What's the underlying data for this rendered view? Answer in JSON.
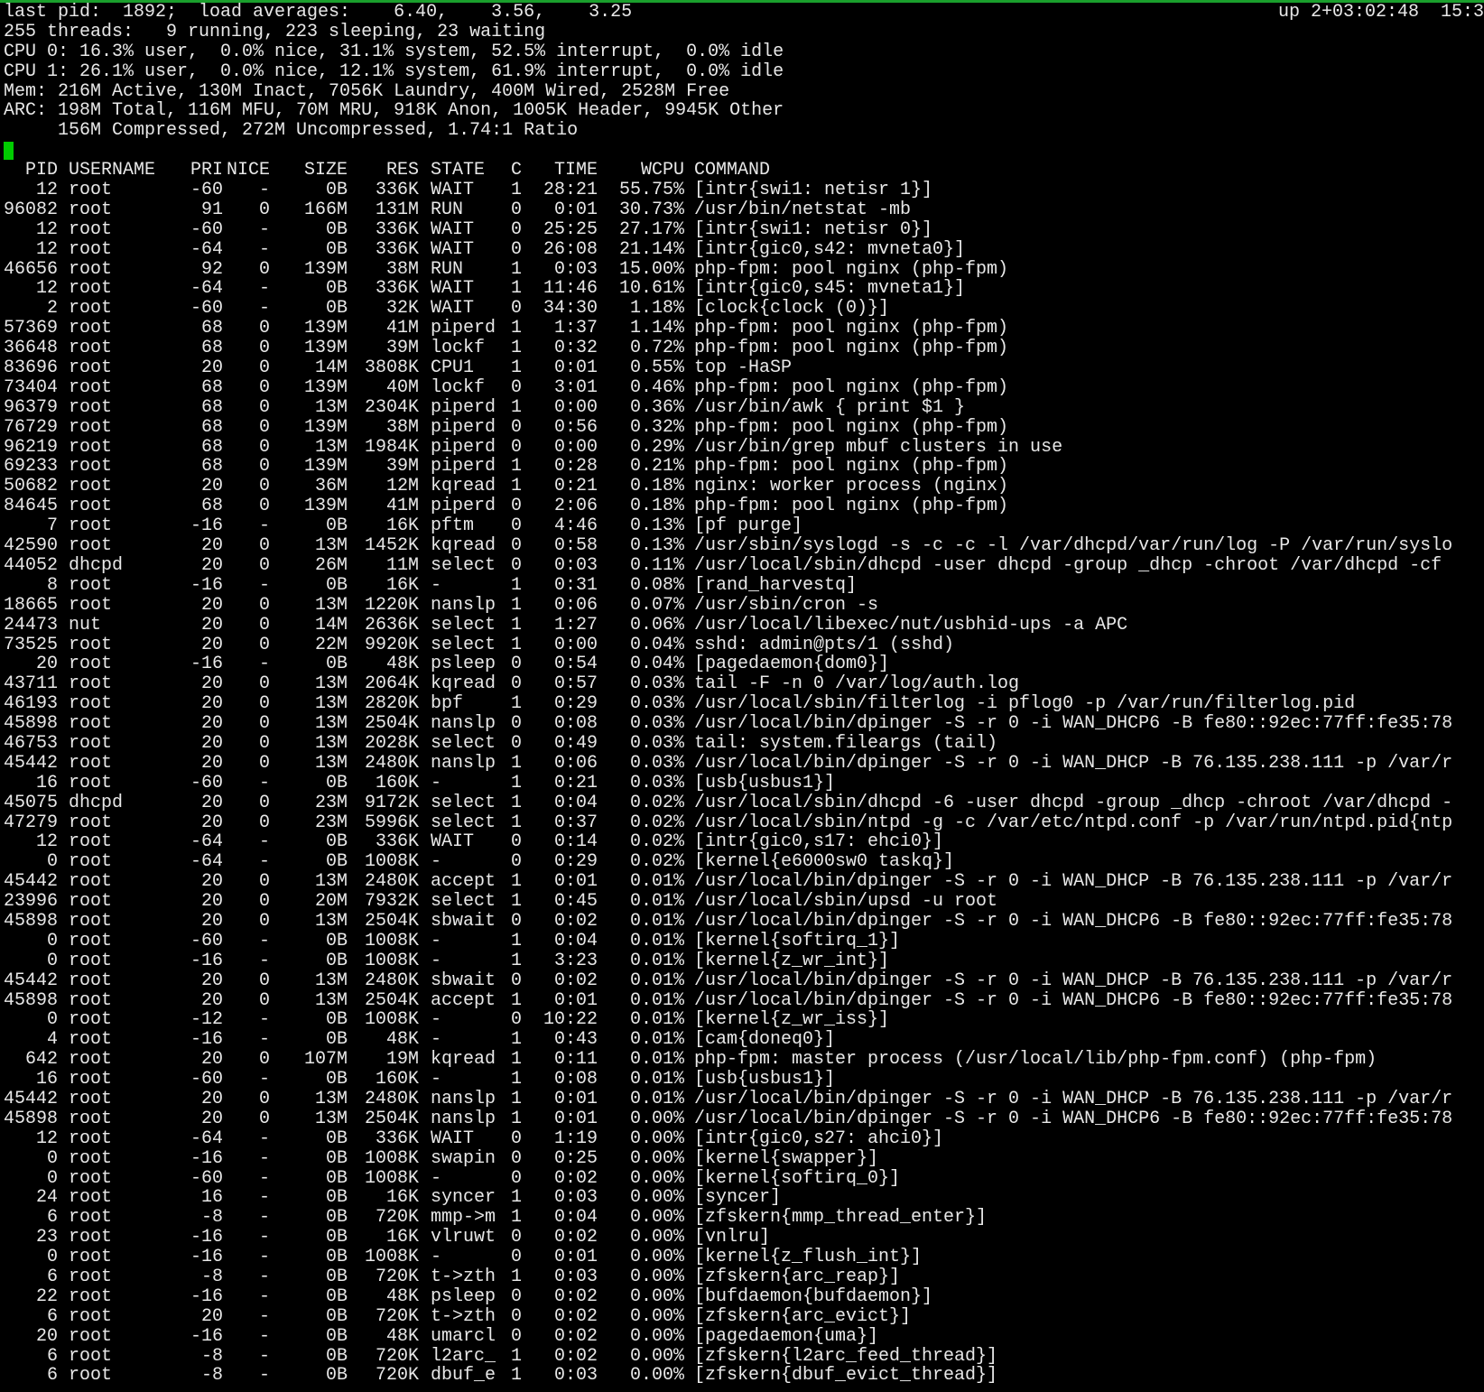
{
  "window": {
    "border_color": "#1a9f2c",
    "cursor_color": "#00cc00"
  },
  "summary": {
    "line1": "last pid:  1892;  load averages:    6.40,    3.56,    3.25",
    "uptime": "up 2+03:02:48  15:3",
    "line2": "255 threads:   9 running, 223 sleeping, 23 waiting",
    "line3": "CPU 0: 16.3% user,  0.0% nice, 31.1% system, 52.5% interrupt,  0.0% idle",
    "line4": "CPU 1: 26.1% user,  0.0% nice, 12.1% system, 61.9% interrupt,  0.0% idle",
    "line5": "Mem: 216M Active, 130M Inact, 7056K Laundry, 400M Wired, 2528M Free",
    "line6": "ARC: 198M Total, 116M MFU, 70M MRU, 918K Anon, 1005K Header, 9945K Other",
    "line7": "     156M Compressed, 272M Uncompressed, 1.74:1 Ratio"
  },
  "columns": [
    "PID",
    "USERNAME",
    "PRI",
    "NICE",
    "SIZE",
    "RES",
    "STATE",
    "C",
    "TIME",
    "WCPU",
    "COMMAND"
  ],
  "processes": [
    [
      "12",
      "root",
      "-60",
      "-",
      "0B",
      "336K",
      "WAIT",
      "1",
      "28:21",
      "55.75%",
      "[intr{swi1: netisr 1}]"
    ],
    [
      "96082",
      "root",
      "91",
      "0",
      "166M",
      "131M",
      "RUN",
      "0",
      "0:01",
      "30.73%",
      "/usr/bin/netstat -mb"
    ],
    [
      "12",
      "root",
      "-60",
      "-",
      "0B",
      "336K",
      "WAIT",
      "0",
      "25:25",
      "27.17%",
      "[intr{swi1: netisr 0}]"
    ],
    [
      "12",
      "root",
      "-64",
      "-",
      "0B",
      "336K",
      "WAIT",
      "0",
      "26:08",
      "21.14%",
      "[intr{gic0,s42: mvneta0}]"
    ],
    [
      "46656",
      "root",
      "92",
      "0",
      "139M",
      "38M",
      "RUN",
      "1",
      "0:03",
      "15.00%",
      "php-fpm: pool nginx (php-fpm)"
    ],
    [
      "12",
      "root",
      "-64",
      "-",
      "0B",
      "336K",
      "WAIT",
      "1",
      "11:46",
      "10.61%",
      "[intr{gic0,s45: mvneta1}]"
    ],
    [
      "2",
      "root",
      "-60",
      "-",
      "0B",
      "32K",
      "WAIT",
      "0",
      "34:30",
      "1.18%",
      "[clock{clock (0)}]"
    ],
    [
      "57369",
      "root",
      "68",
      "0",
      "139M",
      "41M",
      "piperd",
      "1",
      "1:37",
      "1.14%",
      "php-fpm: pool nginx (php-fpm)"
    ],
    [
      "36648",
      "root",
      "68",
      "0",
      "139M",
      "39M",
      "lockf",
      "1",
      "0:32",
      "0.72%",
      "php-fpm: pool nginx (php-fpm)"
    ],
    [
      "83696",
      "root",
      "20",
      "0",
      "14M",
      "3808K",
      "CPU1",
      "1",
      "0:01",
      "0.55%",
      "top -HaSP"
    ],
    [
      "73404",
      "root",
      "68",
      "0",
      "139M",
      "40M",
      "lockf",
      "0",
      "3:01",
      "0.46%",
      "php-fpm: pool nginx (php-fpm)"
    ],
    [
      "96379",
      "root",
      "68",
      "0",
      "13M",
      "2304K",
      "piperd",
      "1",
      "0:00",
      "0.36%",
      "/usr/bin/awk { print $1 }"
    ],
    [
      "76729",
      "root",
      "68",
      "0",
      "139M",
      "38M",
      "piperd",
      "0",
      "0:56",
      "0.32%",
      "php-fpm: pool nginx (php-fpm)"
    ],
    [
      "96219",
      "root",
      "68",
      "0",
      "13M",
      "1984K",
      "piperd",
      "0",
      "0:00",
      "0.29%",
      "/usr/bin/grep mbuf clusters in use"
    ],
    [
      "69233",
      "root",
      "68",
      "0",
      "139M",
      "39M",
      "piperd",
      "1",
      "0:28",
      "0.21%",
      "php-fpm: pool nginx (php-fpm)"
    ],
    [
      "50682",
      "root",
      "20",
      "0",
      "36M",
      "12M",
      "kqread",
      "1",
      "0:21",
      "0.18%",
      "nginx: worker process (nginx)"
    ],
    [
      "84645",
      "root",
      "68",
      "0",
      "139M",
      "41M",
      "piperd",
      "0",
      "2:06",
      "0.18%",
      "php-fpm: pool nginx (php-fpm)"
    ],
    [
      "7",
      "root",
      "-16",
      "-",
      "0B",
      "16K",
      "pftm",
      "0",
      "4:46",
      "0.13%",
      "[pf purge]"
    ],
    [
      "42590",
      "root",
      "20",
      "0",
      "13M",
      "1452K",
      "kqread",
      "0",
      "0:58",
      "0.13%",
      "/usr/sbin/syslogd -s -c -c -l /var/dhcpd/var/run/log -P /var/run/syslo"
    ],
    [
      "44052",
      "dhcpd",
      "20",
      "0",
      "26M",
      "11M",
      "select",
      "0",
      "0:03",
      "0.11%",
      "/usr/local/sbin/dhcpd -user dhcpd -group _dhcp -chroot /var/dhcpd -cf"
    ],
    [
      "8",
      "root",
      "-16",
      "-",
      "0B",
      "16K",
      "-",
      "1",
      "0:31",
      "0.08%",
      "[rand_harvestq]"
    ],
    [
      "18665",
      "root",
      "20",
      "0",
      "13M",
      "1220K",
      "nanslp",
      "1",
      "0:06",
      "0.07%",
      "/usr/sbin/cron -s"
    ],
    [
      "24473",
      "nut",
      "20",
      "0",
      "14M",
      "2636K",
      "select",
      "1",
      "1:27",
      "0.06%",
      "/usr/local/libexec/nut/usbhid-ups -a APC"
    ],
    [
      "73525",
      "root",
      "20",
      "0",
      "22M",
      "9920K",
      "select",
      "1",
      "0:00",
      "0.04%",
      "sshd: admin@pts/1 (sshd)"
    ],
    [
      "20",
      "root",
      "-16",
      "-",
      "0B",
      "48K",
      "psleep",
      "0",
      "0:54",
      "0.04%",
      "[pagedaemon{dom0}]"
    ],
    [
      "43711",
      "root",
      "20",
      "0",
      "13M",
      "2064K",
      "kqread",
      "0",
      "0:57",
      "0.03%",
      "tail -F -n 0 /var/log/auth.log"
    ],
    [
      "46193",
      "root",
      "20",
      "0",
      "13M",
      "2820K",
      "bpf",
      "1",
      "0:29",
      "0.03%",
      "/usr/local/sbin/filterlog -i pflog0 -p /var/run/filterlog.pid"
    ],
    [
      "45898",
      "root",
      "20",
      "0",
      "13M",
      "2504K",
      "nanslp",
      "0",
      "0:08",
      "0.03%",
      "/usr/local/bin/dpinger -S -r 0 -i WAN_DHCP6 -B fe80::92ec:77ff:fe35:78"
    ],
    [
      "46753",
      "root",
      "20",
      "0",
      "13M",
      "2028K",
      "select",
      "0",
      "0:49",
      "0.03%",
      "tail: system.fileargs (tail)"
    ],
    [
      "45442",
      "root",
      "20",
      "0",
      "13M",
      "2480K",
      "nanslp",
      "1",
      "0:06",
      "0.03%",
      "/usr/local/bin/dpinger -S -r 0 -i WAN_DHCP -B 76.135.238.111 -p /var/r"
    ],
    [
      "16",
      "root",
      "-60",
      "-",
      "0B",
      "160K",
      "-",
      "1",
      "0:21",
      "0.03%",
      "[usb{usbus1}]"
    ],
    [
      "45075",
      "dhcpd",
      "20",
      "0",
      "23M",
      "9172K",
      "select",
      "1",
      "0:04",
      "0.02%",
      "/usr/local/sbin/dhcpd -6 -user dhcpd -group _dhcp -chroot /var/dhcpd -"
    ],
    [
      "47279",
      "root",
      "20",
      "0",
      "23M",
      "5996K",
      "select",
      "1",
      "0:37",
      "0.02%",
      "/usr/local/sbin/ntpd -g -c /var/etc/ntpd.conf -p /var/run/ntpd.pid{ntp"
    ],
    [
      "12",
      "root",
      "-64",
      "-",
      "0B",
      "336K",
      "WAIT",
      "0",
      "0:14",
      "0.02%",
      "[intr{gic0,s17: ehci0}]"
    ],
    [
      "0",
      "root",
      "-64",
      "-",
      "0B",
      "1008K",
      "-",
      "0",
      "0:29",
      "0.02%",
      "[kernel{e6000sw0 taskq}]"
    ],
    [
      "45442",
      "root",
      "20",
      "0",
      "13M",
      "2480K",
      "accept",
      "1",
      "0:01",
      "0.01%",
      "/usr/local/bin/dpinger -S -r 0 -i WAN_DHCP -B 76.135.238.111 -p /var/r"
    ],
    [
      "23996",
      "root",
      "20",
      "0",
      "20M",
      "7932K",
      "select",
      "1",
      "0:45",
      "0.01%",
      "/usr/local/sbin/upsd -u root"
    ],
    [
      "45898",
      "root",
      "20",
      "0",
      "13M",
      "2504K",
      "sbwait",
      "0",
      "0:02",
      "0.01%",
      "/usr/local/bin/dpinger -S -r 0 -i WAN_DHCP6 -B fe80::92ec:77ff:fe35:78"
    ],
    [
      "0",
      "root",
      "-60",
      "-",
      "0B",
      "1008K",
      "-",
      "1",
      "0:04",
      "0.01%",
      "[kernel{softirq_1}]"
    ],
    [
      "0",
      "root",
      "-16",
      "-",
      "0B",
      "1008K",
      "-",
      "1",
      "3:23",
      "0.01%",
      "[kernel{z_wr_int}]"
    ],
    [
      "45442",
      "root",
      "20",
      "0",
      "13M",
      "2480K",
      "sbwait",
      "0",
      "0:02",
      "0.01%",
      "/usr/local/bin/dpinger -S -r 0 -i WAN_DHCP -B 76.135.238.111 -p /var/r"
    ],
    [
      "45898",
      "root",
      "20",
      "0",
      "13M",
      "2504K",
      "accept",
      "1",
      "0:01",
      "0.01%",
      "/usr/local/bin/dpinger -S -r 0 -i WAN_DHCP6 -B fe80::92ec:77ff:fe35:78"
    ],
    [
      "0",
      "root",
      "-12",
      "-",
      "0B",
      "1008K",
      "-",
      "0",
      "10:22",
      "0.01%",
      "[kernel{z_wr_iss}]"
    ],
    [
      "4",
      "root",
      "-16",
      "-",
      "0B",
      "48K",
      "-",
      "1",
      "0:43",
      "0.01%",
      "[cam{doneq0}]"
    ],
    [
      "642",
      "root",
      "20",
      "0",
      "107M",
      "19M",
      "kqread",
      "1",
      "0:11",
      "0.01%",
      "php-fpm: master process (/usr/local/lib/php-fpm.conf) (php-fpm)"
    ],
    [
      "16",
      "root",
      "-60",
      "-",
      "0B",
      "160K",
      "-",
      "1",
      "0:08",
      "0.01%",
      "[usb{usbus1}]"
    ],
    [
      "45442",
      "root",
      "20",
      "0",
      "13M",
      "2480K",
      "nanslp",
      "1",
      "0:01",
      "0.01%",
      "/usr/local/bin/dpinger -S -r 0 -i WAN_DHCP -B 76.135.238.111 -p /var/r"
    ],
    [
      "45898",
      "root",
      "20",
      "0",
      "13M",
      "2504K",
      "nanslp",
      "1",
      "0:01",
      "0.00%",
      "/usr/local/bin/dpinger -S -r 0 -i WAN_DHCP6 -B fe80::92ec:77ff:fe35:78"
    ],
    [
      "12",
      "root",
      "-64",
      "-",
      "0B",
      "336K",
      "WAIT",
      "0",
      "1:19",
      "0.00%",
      "[intr{gic0,s27: ahci0}]"
    ],
    [
      "0",
      "root",
      "-16",
      "-",
      "0B",
      "1008K",
      "swapin",
      "0",
      "0:25",
      "0.00%",
      "[kernel{swapper}]"
    ],
    [
      "0",
      "root",
      "-60",
      "-",
      "0B",
      "1008K",
      "-",
      "0",
      "0:02",
      "0.00%",
      "[kernel{softirq_0}]"
    ],
    [
      "24",
      "root",
      "16",
      "-",
      "0B",
      "16K",
      "syncer",
      "1",
      "0:03",
      "0.00%",
      "[syncer]"
    ],
    [
      "6",
      "root",
      "-8",
      "-",
      "0B",
      "720K",
      "mmp->m",
      "1",
      "0:04",
      "0.00%",
      "[zfskern{mmp_thread_enter}]"
    ],
    [
      "23",
      "root",
      "-16",
      "-",
      "0B",
      "16K",
      "vlruwt",
      "0",
      "0:02",
      "0.00%",
      "[vnlru]"
    ],
    [
      "0",
      "root",
      "-16",
      "-",
      "0B",
      "1008K",
      "-",
      "0",
      "0:01",
      "0.00%",
      "[kernel{z_flush_int}]"
    ],
    [
      "6",
      "root",
      "-8",
      "-",
      "0B",
      "720K",
      "t->zth",
      "1",
      "0:03",
      "0.00%",
      "[zfskern{arc_reap}]"
    ],
    [
      "22",
      "root",
      "-16",
      "-",
      "0B",
      "48K",
      "psleep",
      "0",
      "0:02",
      "0.00%",
      "[bufdaemon{bufdaemon}]"
    ],
    [
      "6",
      "root",
      "20",
      "-",
      "0B",
      "720K",
      "t->zth",
      "0",
      "0:02",
      "0.00%",
      "[zfskern{arc_evict}]"
    ],
    [
      "20",
      "root",
      "-16",
      "-",
      "0B",
      "48K",
      "umarcl",
      "0",
      "0:02",
      "0.00%",
      "[pagedaemon{uma}]"
    ],
    [
      "6",
      "root",
      "-8",
      "-",
      "0B",
      "720K",
      "l2arc_",
      "1",
      "0:02",
      "0.00%",
      "[zfskern{l2arc_feed_thread}]"
    ],
    [
      "6",
      "root",
      "-8",
      "-",
      "0B",
      "720K",
      "dbuf_e",
      "1",
      "0:03",
      "0.00%",
      "[zfskern{dbuf_evict_thread}]"
    ]
  ]
}
